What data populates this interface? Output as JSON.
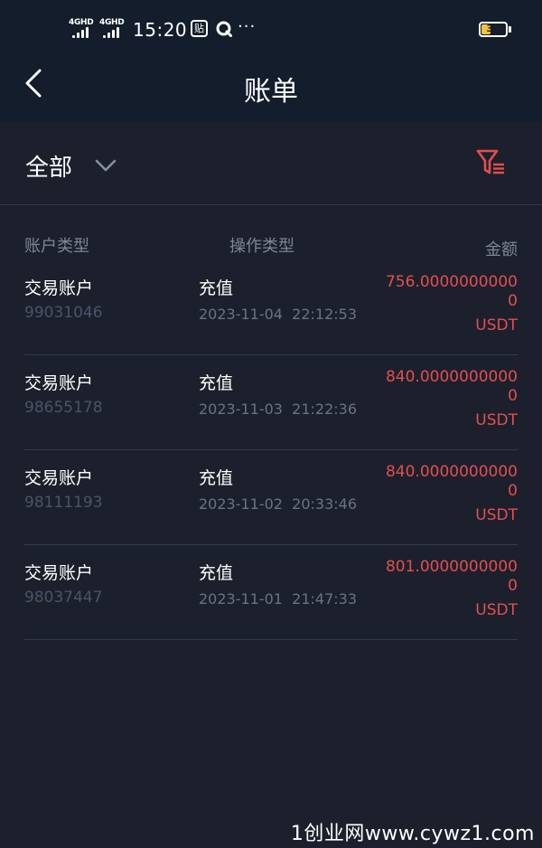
{
  "status_bar": {
    "network_1": "4GHD",
    "network_2": "4GHD",
    "time": "15:20",
    "paste_glyph": "贴",
    "more": "···",
    "battery_level": "39",
    "battery_fill": 0.39,
    "battery_fill_color": "#f4c23b"
  },
  "header": {
    "title": "账单",
    "back_icon": "chevron-left-icon"
  },
  "filter": {
    "selected": "全部",
    "dropdown_icon": "chevron-down-icon",
    "filter_icon": "filter-list-icon",
    "filter_icon_color": "#e24f4f"
  },
  "table": {
    "headers": {
      "account_type": "账户类型",
      "operation_type": "操作类型",
      "amount": "金额"
    },
    "rows": [
      {
        "account_type": "交易账户",
        "account_id": "99031046",
        "operation_type": "充值",
        "time": "2023-11-04  22:12:53",
        "amount": "756.00000000000",
        "unit": "USDT"
      },
      {
        "account_type": "交易账户",
        "account_id": "98655178",
        "operation_type": "充值",
        "time": "2023-11-03  21:22:36",
        "amount": "840.00000000000",
        "unit": "USDT"
      },
      {
        "account_type": "交易账户",
        "account_id": "98111193",
        "operation_type": "充值",
        "time": "2023-11-02  20:33:46",
        "amount": "840.00000000000",
        "unit": "USDT"
      },
      {
        "account_type": "交易账户",
        "account_id": "98037447",
        "operation_type": "充值",
        "time": "2023-11-01  21:47:33",
        "amount": "801.00000000000",
        "unit": "USDT"
      }
    ]
  },
  "colors": {
    "background": "#1c202c",
    "header_background": "#141d2b",
    "amount": "#e24f4f",
    "divider": "#333a4c"
  },
  "watermark": "1创业网www.cywz1.com"
}
